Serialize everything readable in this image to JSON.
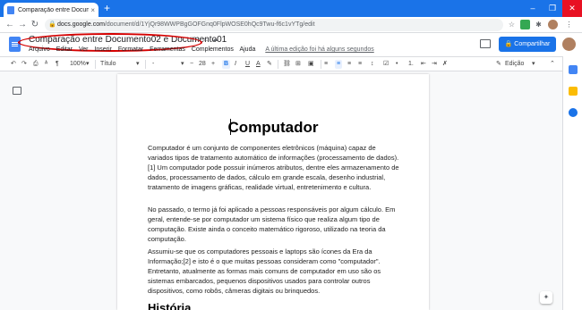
{
  "browser": {
    "tab_title": "Comparação entre Documento02",
    "tab_close": "×",
    "new_tab": "+",
    "url_domain": "docs.google.com",
    "url_path": "/document/d/1YjQr98WWPBgGOFGnq0FlpWOSE0hQc9Twu-f6c1vYTg/edit",
    "window_controls": [
      "–",
      "❐",
      "✕"
    ]
  },
  "docs": {
    "title": "Comparação entre Documento02 e Documento01",
    "menus": [
      "Arquivo",
      "Editar",
      "Ver",
      "Inserir",
      "Formatar",
      "Ferramentas",
      "Complementos",
      "Ajuda"
    ],
    "last_edit": "A última edição foi há alguns segundos",
    "share_label": "Compartilhar"
  },
  "toolbar": {
    "zoom": "100%",
    "style": "Título",
    "font": "-",
    "size": "28",
    "bold": "B",
    "italic": "I",
    "underline": "U",
    "textcolor": "A",
    "mode": "Edição"
  },
  "document": {
    "heading": "Computador",
    "paragraphs": [
      "Computador é um conjunto de componentes eletrônicos (máquina) capaz de variados tipos de tratamento automático de informações (processamento de dados).[1] Um computador pode possuir inúmeros atributos, dentre eles armazenamento de dados, processamento de dados, cálculo em grande escala, desenho industrial, tratamento de imagens gráficas, realidade virtual, entretenimento e cultura.",
      "No passado, o termo já foi aplicado a pessoas responsáveis por algum cálculo. Em geral, entende-se por computador um sistema físico que realiza algum tipo de computação. Existe ainda o conceito matemático rigoroso, utilizado na teoria da computação.",
      "Assumiu-se que os computadores pessoais e laptops são ícones da Era da Informação;[2] e isto é o que muitas pessoas consideram como \"computador\". Entretanto, atualmente as formas mais comuns de computador em uso são os sistemas embarcados, pequenos dispositivos usados para controlar outros dispositivos, como robôs, câmeras digitais ou brinquedos."
    ],
    "subheading": "História"
  },
  "colors": {
    "brand": "#1a73e8",
    "annotation": "#d50000"
  }
}
